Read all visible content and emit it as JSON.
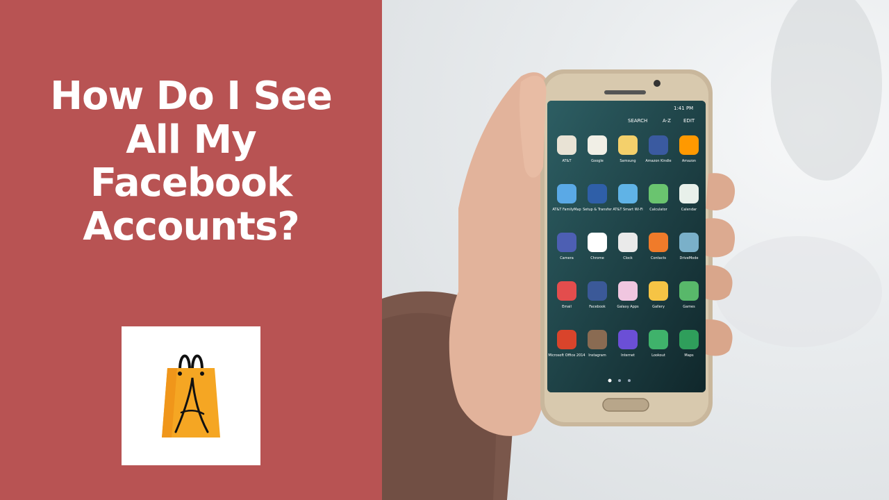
{
  "headline": {
    "lines": [
      "How Do I See",
      "All My",
      "Facebook",
      "Accounts?"
    ]
  },
  "logo": {
    "letter": "A",
    "bag_color": "#f5a623",
    "icon": "shopping-bag-icon"
  },
  "photo": {
    "description_icon": "hand-holding-smartphone",
    "screen": {
      "status_time": "1:41 PM",
      "tabs": [
        "SEARCH",
        "A-Z",
        "EDIT"
      ],
      "apps": [
        "AT&T",
        "Google",
        "Samsung",
        "Amazon Kindle",
        "Amazon",
        "AT&T FamilyMap",
        "Setup & Transfer",
        "AT&T Smart Wi-Fi",
        "Calculator",
        "Calendar",
        "Camera",
        "Chrome",
        "Clock",
        "Contacts",
        "DriveMode",
        "Email",
        "Facebook",
        "Galaxy Apps",
        "Gallery",
        "Games",
        "Microsoft Office 2014",
        "Instagram",
        "Internet",
        "Lookout",
        "Maps"
      ]
    }
  },
  "colors": {
    "panel": "#b85353",
    "title": "#ffffff"
  }
}
